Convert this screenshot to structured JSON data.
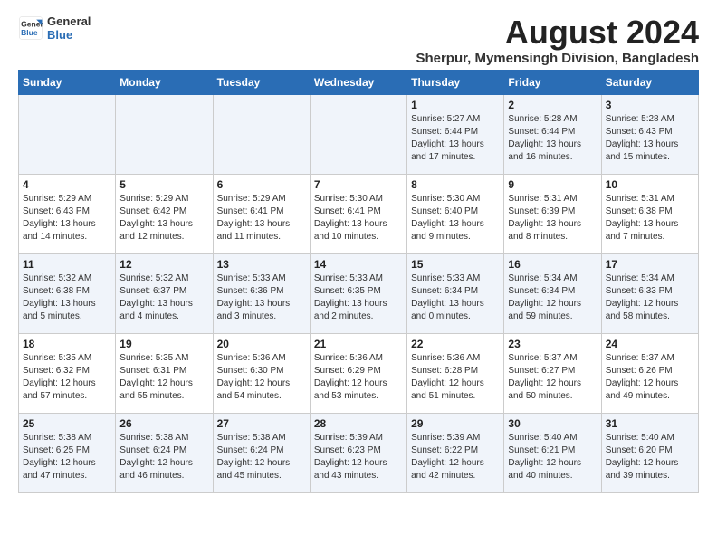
{
  "logo": {
    "line1": "General",
    "line2": "Blue"
  },
  "title": "August 2024",
  "subtitle": "Sherpur, Mymensingh Division, Bangladesh",
  "headers": [
    "Sunday",
    "Monday",
    "Tuesday",
    "Wednesday",
    "Thursday",
    "Friday",
    "Saturday"
  ],
  "weeks": [
    [
      {
        "day": "",
        "info": ""
      },
      {
        "day": "",
        "info": ""
      },
      {
        "day": "",
        "info": ""
      },
      {
        "day": "",
        "info": ""
      },
      {
        "day": "1",
        "info": "Sunrise: 5:27 AM\nSunset: 6:44 PM\nDaylight: 13 hours\nand 17 minutes."
      },
      {
        "day": "2",
        "info": "Sunrise: 5:28 AM\nSunset: 6:44 PM\nDaylight: 13 hours\nand 16 minutes."
      },
      {
        "day": "3",
        "info": "Sunrise: 5:28 AM\nSunset: 6:43 PM\nDaylight: 13 hours\nand 15 minutes."
      }
    ],
    [
      {
        "day": "4",
        "info": "Sunrise: 5:29 AM\nSunset: 6:43 PM\nDaylight: 13 hours\nand 14 minutes."
      },
      {
        "day": "5",
        "info": "Sunrise: 5:29 AM\nSunset: 6:42 PM\nDaylight: 13 hours\nand 12 minutes."
      },
      {
        "day": "6",
        "info": "Sunrise: 5:29 AM\nSunset: 6:41 PM\nDaylight: 13 hours\nand 11 minutes."
      },
      {
        "day": "7",
        "info": "Sunrise: 5:30 AM\nSunset: 6:41 PM\nDaylight: 13 hours\nand 10 minutes."
      },
      {
        "day": "8",
        "info": "Sunrise: 5:30 AM\nSunset: 6:40 PM\nDaylight: 13 hours\nand 9 minutes."
      },
      {
        "day": "9",
        "info": "Sunrise: 5:31 AM\nSunset: 6:39 PM\nDaylight: 13 hours\nand 8 minutes."
      },
      {
        "day": "10",
        "info": "Sunrise: 5:31 AM\nSunset: 6:38 PM\nDaylight: 13 hours\nand 7 minutes."
      }
    ],
    [
      {
        "day": "11",
        "info": "Sunrise: 5:32 AM\nSunset: 6:38 PM\nDaylight: 13 hours\nand 5 minutes."
      },
      {
        "day": "12",
        "info": "Sunrise: 5:32 AM\nSunset: 6:37 PM\nDaylight: 13 hours\nand 4 minutes."
      },
      {
        "day": "13",
        "info": "Sunrise: 5:33 AM\nSunset: 6:36 PM\nDaylight: 13 hours\nand 3 minutes."
      },
      {
        "day": "14",
        "info": "Sunrise: 5:33 AM\nSunset: 6:35 PM\nDaylight: 13 hours\nand 2 minutes."
      },
      {
        "day": "15",
        "info": "Sunrise: 5:33 AM\nSunset: 6:34 PM\nDaylight: 13 hours\nand 0 minutes."
      },
      {
        "day": "16",
        "info": "Sunrise: 5:34 AM\nSunset: 6:34 PM\nDaylight: 12 hours\nand 59 minutes."
      },
      {
        "day": "17",
        "info": "Sunrise: 5:34 AM\nSunset: 6:33 PM\nDaylight: 12 hours\nand 58 minutes."
      }
    ],
    [
      {
        "day": "18",
        "info": "Sunrise: 5:35 AM\nSunset: 6:32 PM\nDaylight: 12 hours\nand 57 minutes."
      },
      {
        "day": "19",
        "info": "Sunrise: 5:35 AM\nSunset: 6:31 PM\nDaylight: 12 hours\nand 55 minutes."
      },
      {
        "day": "20",
        "info": "Sunrise: 5:36 AM\nSunset: 6:30 PM\nDaylight: 12 hours\nand 54 minutes."
      },
      {
        "day": "21",
        "info": "Sunrise: 5:36 AM\nSunset: 6:29 PM\nDaylight: 12 hours\nand 53 minutes."
      },
      {
        "day": "22",
        "info": "Sunrise: 5:36 AM\nSunset: 6:28 PM\nDaylight: 12 hours\nand 51 minutes."
      },
      {
        "day": "23",
        "info": "Sunrise: 5:37 AM\nSunset: 6:27 PM\nDaylight: 12 hours\nand 50 minutes."
      },
      {
        "day": "24",
        "info": "Sunrise: 5:37 AM\nSunset: 6:26 PM\nDaylight: 12 hours\nand 49 minutes."
      }
    ],
    [
      {
        "day": "25",
        "info": "Sunrise: 5:38 AM\nSunset: 6:25 PM\nDaylight: 12 hours\nand 47 minutes."
      },
      {
        "day": "26",
        "info": "Sunrise: 5:38 AM\nSunset: 6:24 PM\nDaylight: 12 hours\nand 46 minutes."
      },
      {
        "day": "27",
        "info": "Sunrise: 5:38 AM\nSunset: 6:24 PM\nDaylight: 12 hours\nand 45 minutes."
      },
      {
        "day": "28",
        "info": "Sunrise: 5:39 AM\nSunset: 6:23 PM\nDaylight: 12 hours\nand 43 minutes."
      },
      {
        "day": "29",
        "info": "Sunrise: 5:39 AM\nSunset: 6:22 PM\nDaylight: 12 hours\nand 42 minutes."
      },
      {
        "day": "30",
        "info": "Sunrise: 5:40 AM\nSunset: 6:21 PM\nDaylight: 12 hours\nand 40 minutes."
      },
      {
        "day": "31",
        "info": "Sunrise: 5:40 AM\nSunset: 6:20 PM\nDaylight: 12 hours\nand 39 minutes."
      }
    ]
  ]
}
